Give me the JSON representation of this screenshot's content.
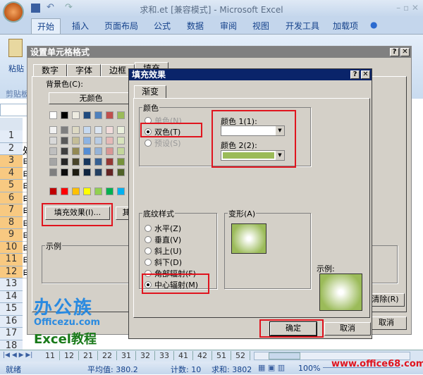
{
  "window": {
    "title": "求和.et  [兼容模式] - Microsoft Excel"
  },
  "ribbon": {
    "tabs": [
      "开始",
      "插入",
      "页面布局",
      "公式",
      "数据",
      "审阅",
      "视图",
      "开发工具",
      "加载项"
    ],
    "paste": "粘贴",
    "clipboard": "剪贴板"
  },
  "sheet": {
    "rows": [
      "1",
      "2",
      "3",
      "4",
      "5",
      "6",
      "7",
      "8",
      "9",
      "10",
      "11",
      "12",
      "13",
      "14",
      "15",
      "16",
      "17",
      "18"
    ],
    "colA": [
      "",
      "处",
      "甲",
      "甲",
      "甲",
      "甲",
      "甲",
      "甲",
      "甲",
      "甲",
      "甲",
      "甲"
    ],
    "tabs": [
      "11",
      "12",
      "21",
      "22",
      "31",
      "32",
      "33",
      "41",
      "42",
      "51",
      "52"
    ]
  },
  "format_dialog": {
    "title": "设置单元格格式",
    "tabs": [
      "数字",
      "字体",
      "边框",
      "填充"
    ],
    "bg_label": "背景色(C):",
    "no_color": "无颜色",
    "fill_effects_button": "填充效果(I)...",
    "other_button": "其",
    "sample_label": "示例",
    "clear_button": "清除(R)",
    "cancel_button": "取消",
    "palette": [
      [
        "#ffffff",
        "#000000",
        "#eeece1",
        "#1f497d",
        "#4f81bd",
        "#c0504d",
        "#9bbb59"
      ],
      [
        "#f2f2f2",
        "#7f7f7f",
        "#ddd9c3",
        "#c6d9f0",
        "#dbe5f1",
        "#f2dcdb",
        "#ebf1dd"
      ],
      [
        "#d8d8d8",
        "#595959",
        "#c4bd97",
        "#8db3e2",
        "#b8cce4",
        "#e5b9b7",
        "#d7e3bc"
      ],
      [
        "#bfbfbf",
        "#3f3f3f",
        "#938953",
        "#548dd4",
        "#95b3d7",
        "#d99694",
        "#c3d69b"
      ],
      [
        "#a5a5a5",
        "#262626",
        "#494429",
        "#17365d",
        "#366092",
        "#953734",
        "#76923c"
      ],
      [
        "#7f7f7f",
        "#0c0c0c",
        "#1d1b10",
        "#0f243e",
        "#244061",
        "#632423",
        "#4f6128"
      ],
      [
        "#c00000",
        "#ff0000",
        "#ffc000",
        "#ffff00",
        "#92d050",
        "#00b050",
        "#00b0f0"
      ]
    ]
  },
  "fill_dialog": {
    "title": "填充效果",
    "tab": "渐变",
    "colors_group": "颜色",
    "radio_one": "单色(N)",
    "radio_two": "双色(T)",
    "radio_preset": "预设(S)",
    "color1_label": "颜色 1(1):",
    "color2_label": "颜色 2(2):",
    "color1": "#ffffff",
    "color2": "#9bbb59",
    "shading_group": "底纹样式",
    "shading": [
      "水平(Z)",
      "垂直(V)",
      "斜上(U)",
      "斜下(D)",
      "角部辐射(F)",
      "中心辐射(M)"
    ],
    "shading_selected": "中心辐射(M)",
    "variants_label": "变形(A)",
    "sample_label": "示例:",
    "ok_button": "确定",
    "cancel_button": "取消"
  },
  "status": {
    "ready": "就绪",
    "average": "平均值: 380.2",
    "count": "计数: 10",
    "sum": "求和: 3802",
    "zoom": "100%"
  },
  "watermark": {
    "logo": "办公族",
    "site": "Officezu.com",
    "tag": "Excel教程",
    "url": "www.office68.com"
  }
}
